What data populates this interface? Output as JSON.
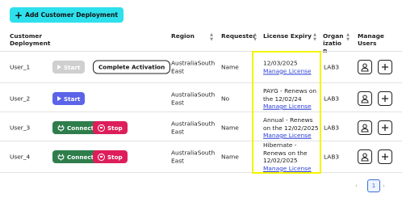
{
  "toolbar": {
    "add_label": "Add Customer Deployment"
  },
  "table": {
    "headers": {
      "deployment": "Customer Deployment",
      "region": "Region",
      "requester": "Requester",
      "license": "License Expiry",
      "organization": "Organization",
      "manage": "Manage Users"
    },
    "rows": [
      {
        "user": "User_1",
        "actions": [
          "Start",
          "Complete Activation"
        ],
        "region": "AustraliaSouthEast",
        "requester": "Name",
        "license_text": "12/03/2025",
        "license_link": "Manage License",
        "org": "LAB3"
      },
      {
        "user": "User_2",
        "actions": [
          "Start"
        ],
        "region": "AustraliaSouthEast",
        "requester": "No",
        "license_text": "PAYG - Renews on the 12/02/24",
        "license_link": "Manage License",
        "org": "LAB3"
      },
      {
        "user": "User_3",
        "actions": [
          "Connect",
          "Stop"
        ],
        "region": "AustraliaSouthEast",
        "requester": "Name",
        "license_text": "Annual - Renews on the 12/02/2025",
        "license_link": "Manage License",
        "org": "LAB3"
      },
      {
        "user": "User_4",
        "actions": [
          "Connect",
          "Stop"
        ],
        "region": "AustraliaSouthEast",
        "requester": "Name",
        "license_text": "Hibernate - Renews on the 12/02/2025",
        "license_link": "Manage License",
        "org": "LAB3"
      }
    ]
  },
  "pagination": {
    "current": "1"
  },
  "colors": {
    "add_button": "#2ee0ec",
    "start": "#5b63e8",
    "start_disabled": "#cfcfcf",
    "connect": "#2e7d4b",
    "stop": "#dd1e5a",
    "link": "#2b3fd6",
    "highlight": "#f4f400"
  }
}
